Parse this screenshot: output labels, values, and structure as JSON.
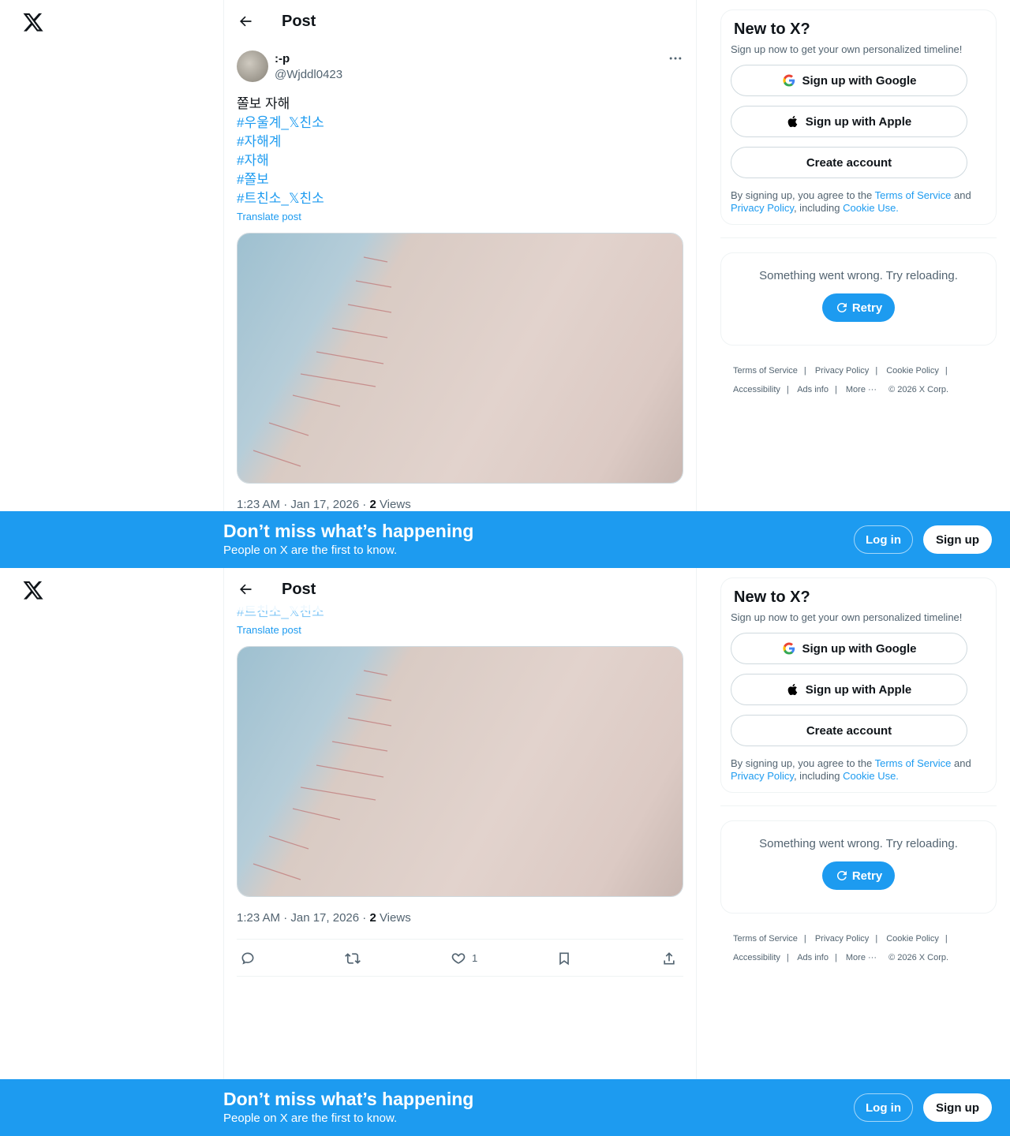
{
  "post_header": {
    "title": "Post"
  },
  "author": {
    "display_name": ":-p",
    "handle": "@Wjddl0423"
  },
  "post": {
    "text": "쫄보 자해",
    "hashtags": [
      "#우울계_𝕏친소",
      "#자해계",
      "#자해",
      "#쫄보",
      "#트친소_𝕏친소"
    ],
    "translate_label": "Translate post",
    "time": "1:23 AM · Jan 17, 2026 · ",
    "views_count": "2",
    "views_label": " Views",
    "likes": "1"
  },
  "signup_card": {
    "title": "New to X?",
    "subtitle": "Sign up now to get your own personalized timeline!",
    "google_label": "Sign up with Google",
    "apple_label": "Sign up with Apple",
    "create_label": "Create account",
    "terms_prefix": "By signing up, you agree to the ",
    "terms_link": "Terms of Service",
    "terms_and": " and ",
    "privacy_link": "Privacy Policy",
    "terms_including": ", including ",
    "cookie_link": "Cookie Use."
  },
  "error_card": {
    "message": "Something went wrong. Try reloading.",
    "retry_label": "Retry"
  },
  "footer": {
    "terms": "Terms of Service",
    "privacy": "Privacy Policy",
    "cookie": "Cookie Policy",
    "accessibility": "Accessibility",
    "ads": "Ads info",
    "more": "More ···",
    "copyright": "© 2026 X Corp."
  },
  "banner": {
    "title": "Don’t miss what’s happening",
    "subtitle": "People on X are the first to know.",
    "login_label": "Log in",
    "signup_label": "Sign up"
  }
}
